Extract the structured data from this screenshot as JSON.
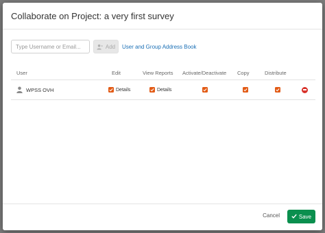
{
  "modal": {
    "title": "Collaborate on Project: a very first survey"
  },
  "add_collaborator": {
    "input_placeholder": "Type Username or Email...",
    "input_value": "",
    "add_label": "Add",
    "address_book_link": "User and Group Address Book"
  },
  "table": {
    "columns": [
      "User",
      "Edit",
      "View Reports",
      "Activate/Deactivate",
      "Copy",
      "Distribute"
    ],
    "rows": [
      {
        "user": "WPSS OVH",
        "edit": {
          "checked": true,
          "details_label": "Details"
        },
        "view_reports": {
          "checked": true,
          "details_label": "Details"
        },
        "activate_deactivate": true,
        "copy": true,
        "distribute": true
      }
    ]
  },
  "footer": {
    "cancel_label": "Cancel",
    "save_label": "Save"
  },
  "colors": {
    "checkbox": "#e25b16",
    "save_button": "#0a8f4e",
    "link": "#1a6fb5",
    "remove": "#d8322b"
  },
  "icons": {
    "add_button": "person-add-icon",
    "user": "person-icon",
    "remove": "remove-circle-icon",
    "save": "checkmark-icon",
    "checkbox": "checkmark-icon"
  }
}
